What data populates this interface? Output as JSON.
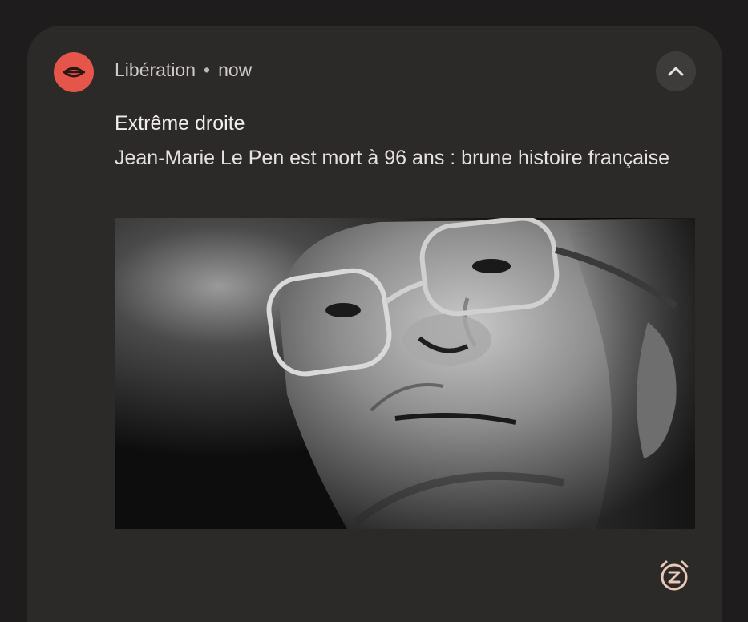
{
  "notification": {
    "app_name": "Libération",
    "separator": "•",
    "time": "now",
    "app_icon": "liberation-logo-icon",
    "expand_icon": "chevron-up-icon",
    "title": "Extrême droite",
    "body": "Jean-Marie Le Pen est mort à 96 ans : brune histoire française",
    "image": "black-and-white close-up portrait photo",
    "snooze_icon": "snooze-alarm-icon"
  },
  "colors": {
    "background": "#1e1c1c",
    "card": "#2c2929",
    "app_icon": "#e5554a",
    "button": "#3e3b3b",
    "title_text": "#f1eeec",
    "secondary_text": "#cfc9c7",
    "snooze_icon": "#e9c9b8"
  }
}
